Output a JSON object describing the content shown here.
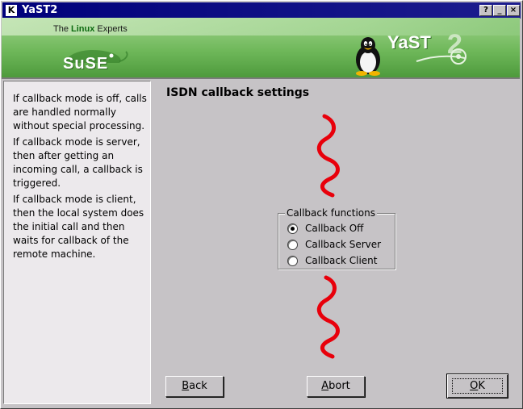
{
  "window": {
    "title": "YaST2",
    "app_icon": "K",
    "buttons": {
      "help": "?",
      "minimize": "_",
      "close": "×"
    }
  },
  "banner": {
    "tagline_prefix": "The ",
    "tagline_highlight": "Linux",
    "tagline_suffix": " Experts",
    "suse_logo_text": "SuSE",
    "yast_logo_text": "YaST"
  },
  "help": {
    "paragraphs": [
      "If callback mode is off, calls are handled normally without special processing.",
      "If callback mode is server, then after getting an incoming call, a callback is triggered.",
      "If callback mode is client, then the local system does the initial call and then waits for callback of the remote machine."
    ]
  },
  "main": {
    "title": "ISDN callback settings",
    "group_label": "Callback functions",
    "options": [
      {
        "label": "Callback Off",
        "checked": true
      },
      {
        "label": "Callback Server",
        "checked": false
      },
      {
        "label": "Callback Client",
        "checked": false
      }
    ]
  },
  "buttons": {
    "back_hotkey": "B",
    "back_rest": "ack",
    "abort_hotkey": "A",
    "abort_rest": "bort",
    "ok_hotkey": "O",
    "ok_rest": "K"
  },
  "colors": {
    "titlebar": "#00007b",
    "banner_green": "#6fb85a",
    "squiggle": "#e8000b"
  }
}
